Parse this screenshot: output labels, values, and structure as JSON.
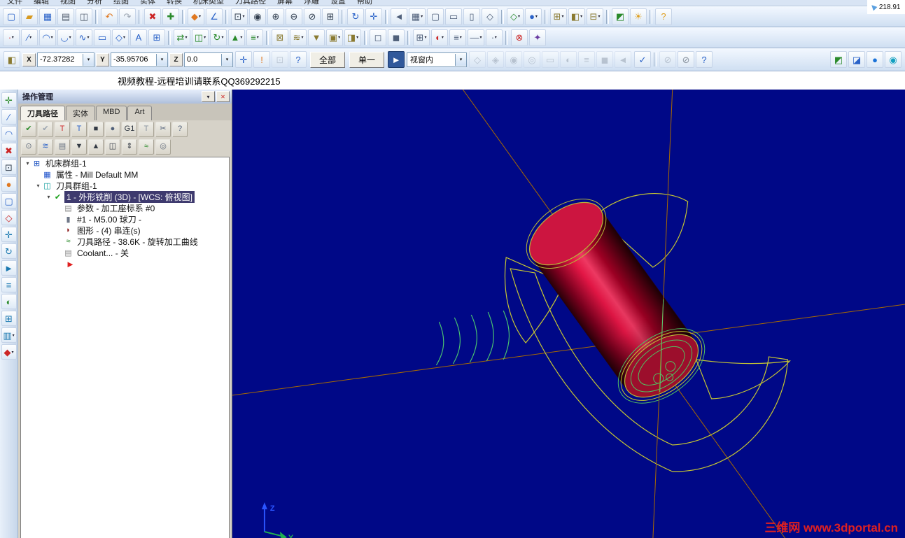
{
  "menu": {
    "items": [
      "文件",
      "编辑",
      "视图",
      "分析",
      "绘图",
      "实体",
      "转换",
      "机床类型",
      "刀具路径",
      "屏幕",
      "浮雕",
      "设置",
      "帮助"
    ]
  },
  "toolbars": {
    "row1": [
      {
        "n": "new-file",
        "g": "▢",
        "c": "#2a62c8"
      },
      {
        "n": "open-file",
        "g": "▰",
        "c": "#d89a20"
      },
      {
        "n": "save-file",
        "g": "▦",
        "c": "#2a62c8"
      },
      {
        "n": "print",
        "g": "▤",
        "c": "#556070"
      },
      {
        "n": "print-preview",
        "g": "◫",
        "c": "#556070"
      },
      {
        "sep": true
      },
      {
        "n": "undo",
        "g": "↶",
        "c": "#e07820"
      },
      {
        "n": "redo",
        "g": "↷",
        "c": "#9aa4b0"
      },
      {
        "sep": true
      },
      {
        "n": "delete-entities",
        "g": "✖",
        "c": "#cc2626"
      },
      {
        "n": "undelete-entities",
        "g": "✚",
        "c": "#2a8a2a"
      },
      {
        "sep": true
      },
      {
        "n": "analyze-position",
        "g": "◆",
        "c": "#e07820",
        "d": true
      },
      {
        "n": "analyze-distance",
        "g": "∠",
        "c": "#2a62c8"
      },
      {
        "sep": true
      },
      {
        "n": "zoom-window",
        "g": "⊡",
        "c": "#334050",
        "d": true
      },
      {
        "n": "zoom-target",
        "g": "◉",
        "c": "#334050"
      },
      {
        "n": "zoom-in",
        "g": "⊕",
        "c": "#334050"
      },
      {
        "n": "zoom-out",
        "g": "⊖",
        "c": "#334050"
      },
      {
        "n": "zoom-previous",
        "g": "⊘",
        "c": "#334050"
      },
      {
        "n": "fit-screen",
        "g": "⊞",
        "c": "#334050"
      },
      {
        "sep": true
      },
      {
        "n": "dynamic-rotate",
        "g": "↻",
        "c": "#2a62c8"
      },
      {
        "n": "pan",
        "g": "✛",
        "c": "#2a62c8"
      },
      {
        "sep": true
      },
      {
        "n": "previous-view",
        "g": "◄",
        "c": "#50607a"
      },
      {
        "n": "named-views",
        "g": "▦",
        "c": "#50607a",
        "d": true
      },
      {
        "n": "top-view",
        "g": "▢",
        "c": "#50607a"
      },
      {
        "n": "front-view",
        "g": "▭",
        "c": "#50607a"
      },
      {
        "n": "side-view",
        "g": "▯",
        "c": "#50607a"
      },
      {
        "n": "isometric-view",
        "g": "◇",
        "c": "#50607a"
      },
      {
        "sep": true
      },
      {
        "n": "wireframe-display",
        "g": "◇",
        "c": "#2a8a2a",
        "d": true
      },
      {
        "n": "shaded-display",
        "g": "●",
        "c": "#2a62c8",
        "d": true
      },
      {
        "sep": true
      },
      {
        "n": "gview-select",
        "g": "⊞",
        "c": "#8a7a30",
        "d": true
      },
      {
        "n": "cplane-select",
        "g": "◧",
        "c": "#8a7a30",
        "d": true
      },
      {
        "n": "wcs-select",
        "g": "⊟",
        "c": "#8a7a30",
        "d": true
      },
      {
        "sep": true
      },
      {
        "n": "render",
        "g": "◩",
        "c": "#2a8a2a"
      },
      {
        "n": "lighting",
        "g": "☀",
        "c": "#e0a020"
      },
      {
        "sep": true
      },
      {
        "n": "help",
        "g": "?",
        "c": "#e0a020"
      }
    ],
    "row2": [
      {
        "n": "create-point",
        "g": "∙",
        "c": "#cc2626",
        "d": true
      },
      {
        "n": "create-line",
        "g": "∕",
        "c": "#2a62c8",
        "d": true
      },
      {
        "n": "create-arc",
        "g": "◠",
        "c": "#2a62c8",
        "d": true
      },
      {
        "n": "create-fillet",
        "g": "◡",
        "c": "#2a62c8",
        "d": true
      },
      {
        "n": "create-spline",
        "g": "∿",
        "c": "#2a62c8",
        "d": true
      },
      {
        "n": "create-rectangle",
        "g": "▭",
        "c": "#2a62c8"
      },
      {
        "n": "create-polygon",
        "g": "◇",
        "c": "#2a62c8",
        "d": true
      },
      {
        "n": "create-letters",
        "g": "A",
        "c": "#2a62c8"
      },
      {
        "n": "create-bounding-box",
        "g": "⊞",
        "c": "#2a62c8"
      },
      {
        "sep": true
      },
      {
        "n": "xform-translate",
        "g": "⇄",
        "c": "#2a8a2a",
        "d": true
      },
      {
        "n": "xform-mirror",
        "g": "◫",
        "c": "#2a8a2a",
        "d": true
      },
      {
        "n": "xform-rotate",
        "g": "↻",
        "c": "#2a8a2a",
        "d": true
      },
      {
        "n": "xform-scale",
        "g": "▲",
        "c": "#2a8a2a",
        "d": true
      },
      {
        "n": "xform-offset",
        "g": "≡",
        "c": "#2a8a2a",
        "d": true
      },
      {
        "sep": true
      },
      {
        "n": "machine-definition",
        "g": "⊠",
        "c": "#8a7a30"
      },
      {
        "n": "toolpath-contour",
        "g": "≋",
        "c": "#8a7a30",
        "d": true
      },
      {
        "n": "toolpath-drill",
        "g": "▼",
        "c": "#8a7a30"
      },
      {
        "n": "toolpath-pocket",
        "g": "▣",
        "c": "#8a7a30",
        "d": true
      },
      {
        "n": "toolpath-face",
        "g": "◨",
        "c": "#8a7a30",
        "d": true
      },
      {
        "sep": true
      },
      {
        "n": "blank-entity",
        "g": "◻",
        "c": "#50607a"
      },
      {
        "n": "unblank-entity",
        "g": "◼",
        "c": "#50607a"
      },
      {
        "sep": true
      },
      {
        "n": "grid-settings",
        "g": "⊞",
        "c": "#50607a",
        "d": true
      },
      {
        "n": "attribute-color",
        "g": "◐",
        "c": "#cc2626",
        "d": true
      },
      {
        "n": "attribute-level",
        "g": "≡",
        "c": "#50607a",
        "d": true
      },
      {
        "n": "attribute-linestyle",
        "g": "—",
        "c": "#50607a",
        "d": true
      },
      {
        "n": "attribute-pointstyle",
        "g": "∙",
        "c": "#50607a",
        "d": true
      },
      {
        "sep": true
      },
      {
        "n": "delete-duplicates",
        "g": "⊗",
        "c": "#cc2626"
      },
      {
        "n": "run-addin",
        "g": "✦",
        "c": "#6a3aa0"
      }
    ]
  },
  "coord": {
    "x_label": "X",
    "x_value": "-72.37282",
    "y_label": "Y",
    "y_value": "-35.95706",
    "z_label": "Z",
    "z_value": "0.0",
    "all_button": "全部",
    "single_button": "单一",
    "window_mode": "视窗内",
    "icons_mid": [
      {
        "n": "fast-point",
        "g": "✛",
        "c": "#2a62c8"
      },
      {
        "n": "apply",
        "g": "!",
        "c": "#e07820"
      },
      {
        "n": "cursor-tracking",
        "g": "⊡",
        "c": "#9aa4b0",
        "dim": true
      },
      {
        "n": "help-coordinates",
        "g": "?",
        "c": "#2a62c8"
      }
    ],
    "selection_icons": [
      {
        "n": "select-in",
        "g": "◇",
        "c": "#8a94a0",
        "dim": true
      },
      {
        "n": "select-in-intersect",
        "g": "◈",
        "c": "#8a94a0",
        "dim": true
      },
      {
        "n": "select-intersect",
        "g": "◉",
        "c": "#8a94a0",
        "dim": true
      },
      {
        "n": "select-out-intersect",
        "g": "◎",
        "c": "#8a94a0",
        "dim": true
      },
      {
        "n": "select-out",
        "g": "▭",
        "c": "#8a94a0",
        "dim": true
      },
      {
        "n": "select-by-color",
        "g": "◐",
        "c": "#8a94a0",
        "dim": true
      },
      {
        "n": "select-by-level",
        "g": "≡",
        "c": "#8a94a0",
        "dim": true
      },
      {
        "n": "select-solids",
        "g": "◼",
        "c": "#8a94a0",
        "dim": true
      },
      {
        "n": "select-last",
        "g": "◄",
        "c": "#8a94a0",
        "dim": true
      }
    ],
    "end_icons": [
      {
        "n": "validate-selection",
        "g": "✓",
        "c": "#2a62c8"
      },
      {
        "sep": true
      },
      {
        "n": "limit-entity",
        "g": "⊘",
        "c": "#8a94a0",
        "dim": true
      },
      {
        "n": "clear-masks",
        "g": "⊘",
        "c": "#8a94a0"
      },
      {
        "n": "help-selection",
        "g": "?",
        "c": "#2a62c8"
      }
    ],
    "view_icons": [
      {
        "n": "gview-cube",
        "g": "◩",
        "c": "#2a8a2a"
      },
      {
        "n": "planes-cube",
        "g": "◪",
        "c": "#2a62c8"
      },
      {
        "n": "shaded-sphere",
        "g": "●",
        "c": "#1a72d8"
      },
      {
        "n": "glossy-sphere",
        "g": "◉",
        "c": "#12a0c0"
      }
    ]
  },
  "banner": {
    "text": "视频教程-远程培训请联系QQ369292215"
  },
  "leftbar": {
    "icons": [
      {
        "n": "mru-analyze",
        "g": "✛",
        "c": "#2a8a2a"
      },
      {
        "n": "mru-create-line",
        "g": "∕",
        "c": "#2a62c8"
      },
      {
        "n": "mru-create-arc",
        "g": "◠",
        "c": "#2a62c8"
      },
      {
        "n": "mru-delete",
        "g": "✖",
        "c": "#cc2626"
      },
      {
        "n": "mru-zoom-fit",
        "g": "⊡",
        "c": "#334050"
      },
      {
        "n": "mru-shading",
        "g": "●",
        "c": "#e07820"
      },
      {
        "n": "mru-top-view",
        "g": "▢",
        "c": "#2a62c8"
      },
      {
        "n": "mru-iso-view",
        "g": "◇",
        "c": "#cc2626"
      },
      {
        "n": "mru-pan",
        "g": "✛",
        "c": "#1a78b0"
      },
      {
        "n": "mru-rotate",
        "g": "↻",
        "c": "#1a78b0"
      },
      {
        "n": "mru-select",
        "g": "►",
        "c": "#1a78b0"
      },
      {
        "n": "mru-levels",
        "g": "≡",
        "c": "#1a78b0"
      },
      {
        "n": "mru-attributes",
        "g": "◐",
        "c": "#2a8a2a"
      },
      {
        "n": "mru-grid",
        "g": "⊞",
        "c": "#1a78b0"
      },
      {
        "n": "mru-viewsheet",
        "g": "▥",
        "c": "#1a78b0",
        "d": true
      },
      {
        "n": "mru-more-tools",
        "g": "◆",
        "c": "#cc2626",
        "d": true
      }
    ]
  },
  "ops_panel": {
    "title": "操作管理",
    "tabs": [
      "刀具路径",
      "实体",
      "MBD",
      "Art"
    ],
    "toolbar1": [
      {
        "n": "select-all-operations",
        "g": "✔",
        "c": "#2a8a2a"
      },
      {
        "n": "reset-selection",
        "g": "✔",
        "c": "#9aa4b0"
      },
      {
        "n": "regen-selected",
        "g": "T",
        "c": "#cc2626"
      },
      {
        "n": "regen-all",
        "g": "T",
        "c": "#2a62c8"
      },
      {
        "n": "backplot",
        "g": "■",
        "c": "#333a44"
      },
      {
        "n": "verify",
        "g": "●",
        "c": "#50607a"
      },
      {
        "n": "post-selected",
        "g": "G1",
        "c": "#333a44"
      },
      {
        "n": "highfeed",
        "g": "T",
        "c": "#8a94a0"
      },
      {
        "n": "delete-operations",
        "g": "✂",
        "c": "#50607a"
      },
      {
        "n": "help-operations",
        "g": "?",
        "c": "#50607a"
      }
    ],
    "toolbar2": [
      {
        "n": "lock-toolpath",
        "g": "⊙",
        "c": "#667080"
      },
      {
        "n": "toggle-toolpath-display",
        "g": "≋",
        "c": "#2a62c8"
      },
      {
        "n": "toggle-posting",
        "g": "▤",
        "c": "#667080"
      },
      {
        "n": "move-insert-down",
        "g": "▼",
        "c": "#333a44"
      },
      {
        "n": "move-insert-up",
        "g": "▲",
        "c": "#333a44"
      },
      {
        "n": "insert-arrow-special",
        "g": "◫",
        "c": "#333a44"
      },
      {
        "n": "scroll-insert",
        "g": "⇕",
        "c": "#333a44"
      },
      {
        "n": "only-display-selected",
        "g": "≈",
        "c": "#2a8a2a"
      },
      {
        "n": "manager-options",
        "g": "◎",
        "c": "#667080"
      }
    ],
    "tree": [
      {
        "ind": 0,
        "exp": true,
        "g": "⊞",
        "c": "#1a50c0",
        "label": "机床群组-1"
      },
      {
        "ind": 1,
        "g": "▦",
        "c": "#2255cc",
        "label": "属性 - Mill Default MM"
      },
      {
        "ind": 1,
        "exp": true,
        "g": "◫",
        "c": "#0a9a9a",
        "label": "刀具群组-1"
      },
      {
        "ind": 2,
        "exp": true,
        "g": "✔",
        "c": "#18a018",
        "label": "1 - 外形铣削 (3D) - [WCS: 俯视图]",
        "sel": true
      },
      {
        "ind": 3,
        "g": "▤",
        "c": "#888888",
        "label": "参数 - 加工座标系 #0"
      },
      {
        "ind": 3,
        "g": "▮",
        "c": "#707888",
        "label": "#1 - M5.00 球刀 - "
      },
      {
        "ind": 3,
        "g": "◗",
        "c": "#8b1a1a",
        "label": "图形 - (4) 串连(s)"
      },
      {
        "ind": 3,
        "g": "≈",
        "c": "#2a8a2a",
        "label": "刀具路径 - 38.6K - 旋转加工曲线"
      },
      {
        "ind": 3,
        "g": "▤",
        "c": "#888888",
        "label": "Coolant... - 关"
      },
      {
        "ind": 4,
        "arrow": true
      }
    ]
  },
  "viewport": {
    "watermark": "三维网 www.3dportal.cn",
    "axis_y": "Y",
    "axis_z": "Z"
  },
  "overlay": {
    "coords_value": "218.91"
  },
  "colors": {
    "viewport_bg": "#000887",
    "selection_highlight": "#3e3a6e",
    "model_red": "#e61646",
    "wireframe_yellow": "#c6c632",
    "curve_green": "#49c070",
    "axis_orange": "#a86a00",
    "watermark_red": "#e02020"
  }
}
